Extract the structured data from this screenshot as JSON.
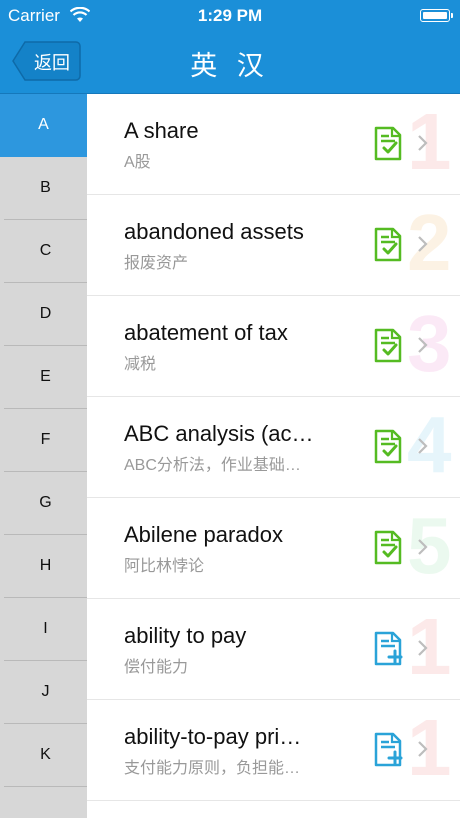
{
  "status_bar": {
    "carrier": "Carrier",
    "time": "1:29 PM"
  },
  "nav": {
    "back_label": "返回",
    "title": "英 汉"
  },
  "sidebar": {
    "letters": [
      "A",
      "B",
      "C",
      "D",
      "E",
      "F",
      "G",
      "H",
      "I",
      "J",
      "K"
    ],
    "active": "A"
  },
  "entries": [
    {
      "term": "A share",
      "translation": "A股",
      "badge": "1",
      "badge_color": "#f3a0a0",
      "icon": "check-document-icon",
      "icon_color": "#55bb22"
    },
    {
      "term": "abandoned assets",
      "translation": "报废资产",
      "badge": "2",
      "badge_color": "#f5c98a",
      "icon": "check-document-icon",
      "icon_color": "#55bb22"
    },
    {
      "term": "abatement of tax",
      "translation": "减税",
      "badge": "3",
      "badge_color": "#f0a0d8",
      "icon": "check-document-icon",
      "icon_color": "#55bb22"
    },
    {
      "term": "ABC analysis (ac…",
      "translation": "ABC分析法，作业基础…",
      "badge": "4",
      "badge_color": "#8fd3f0",
      "icon": "check-document-icon",
      "icon_color": "#55bb22"
    },
    {
      "term": "Abilene paradox",
      "translation": "阿比林悖论",
      "badge": "5",
      "badge_color": "#a8e6b8",
      "icon": "check-document-icon",
      "icon_color": "#55bb22"
    },
    {
      "term": "ability to pay",
      "translation": "偿付能力",
      "badge": "1",
      "badge_color": "#f3a0a0",
      "icon": "add-document-icon",
      "icon_color": "#2aa3d8"
    },
    {
      "term": "ability-to-pay pri…",
      "translation": "支付能力原则，负担能…",
      "badge": "1",
      "badge_color": "#f3a0a0",
      "icon": "add-document-icon",
      "icon_color": "#2aa3d8"
    }
  ]
}
